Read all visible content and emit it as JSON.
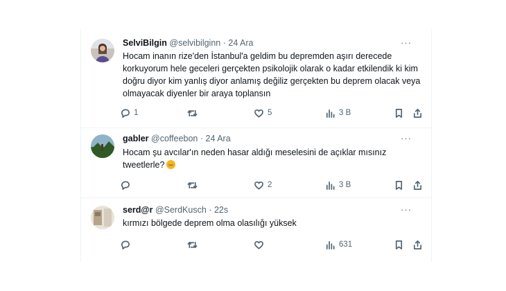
{
  "tweets": [
    {
      "name": "SelviBilgin",
      "handle": "@selvibilginn",
      "sep": "·",
      "time": "24 Ara",
      "more": "···",
      "text": "Hocam inanın rize'den İstanbul'a geldim bu depremden aşırı derecede korkuyorum hele geceleri gerçekten psikolojik olarak o kadar etkilendik ki kim doğru diyor kim yanlış diyor anlamış değiliz gerçekten bu deprem olacak veya olmayacak diyenler bir araya toplansın",
      "replies": "1",
      "retweets": "",
      "likes": "5",
      "views": "3 B"
    },
    {
      "name": "gabler",
      "handle": "@coffeebon",
      "sep": "·",
      "time": "24 Ara",
      "more": "···",
      "text": "Hocam şu avcılar'ın neden hasar aldığı meselesini de açıklar mısınız tweetlerle?",
      "emoji": "smiling-face-emoji",
      "replies": "",
      "retweets": "",
      "likes": "2",
      "views": "3 B"
    },
    {
      "name": "serd@r",
      "handle": "@SerdKusch",
      "sep": "·",
      "time": "22s",
      "more": "···",
      "text": "kırmızı bölgede deprem olma olasılığı yüksek",
      "replies": "",
      "retweets": "",
      "likes": "",
      "views": "631"
    }
  ],
  "colors": {
    "text": "#0f1419",
    "secondary": "#536471",
    "divider": "#eff3f4"
  },
  "icons": [
    "reply-icon",
    "retweet-icon",
    "like-icon",
    "views-icon",
    "bookmark-icon",
    "share-icon",
    "more-icon"
  ]
}
